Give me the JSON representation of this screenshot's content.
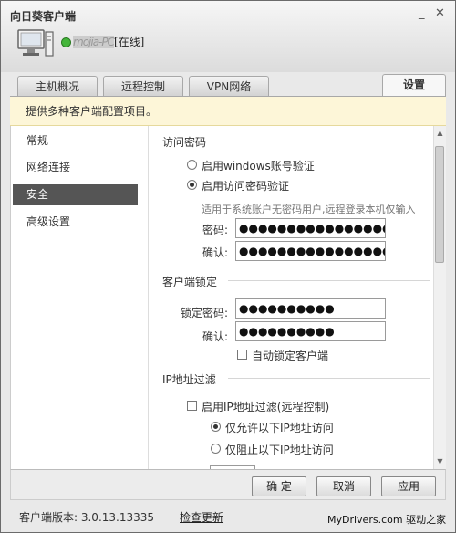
{
  "window": {
    "title": "向日葵客户端",
    "minimize_glyph": "_",
    "close_glyph": "✕"
  },
  "user": {
    "name": "mojia-PC",
    "status": "[在线]",
    "status_color": "#44b53a"
  },
  "tabs": [
    {
      "label": "主机概况",
      "active": false
    },
    {
      "label": "远程控制",
      "active": false
    },
    {
      "label": "VPN网络",
      "active": false
    },
    {
      "label": "设置",
      "active": true
    }
  ],
  "banner": "提供多种客户端配置项目。",
  "sidebar": {
    "items": [
      {
        "label": "常规"
      },
      {
        "label": "网络连接"
      },
      {
        "label": "安全",
        "active": true
      },
      {
        "label": "高级设置"
      }
    ]
  },
  "access_password": {
    "title": "访问密码",
    "option_windows": "启用windows账号验证",
    "option_password": "启用访问密码验证",
    "note": "适用于系统账户无密码用户,远程登录本机仅输入",
    "password_label": "密码:",
    "password_value": "●●●●●●●●●●●●●●●●",
    "confirm_label": "确认:",
    "confirm_value": "●●●●●●●●●●●●●●●●",
    "selected": "password"
  },
  "client_lock": {
    "title": "客户端锁定",
    "lock_password_label": "锁定密码:",
    "lock_password_value": "●●●●●●●●●●",
    "confirm_label": "确认:",
    "confirm_value": "●●●●●●●●●●",
    "auto_lock_label": "自动锁定客户端",
    "auto_lock_checked": false
  },
  "ip_filter": {
    "title": "IP地址过滤",
    "enable_label": "启用IP地址过滤(远程控制)",
    "enable_checked": false,
    "allow_label": "仅允许以下IP地址访问",
    "deny_label": "仅阻止以下IP地址访问",
    "selected": "allow"
  },
  "buttons": {
    "ok": "确 定",
    "cancel": "取消",
    "apply": "应用"
  },
  "footer": {
    "version": "客户端版本: 3.0.13.13335",
    "check_update": "检查更新",
    "watermark": "MyDrivers.com 驱动之家"
  }
}
